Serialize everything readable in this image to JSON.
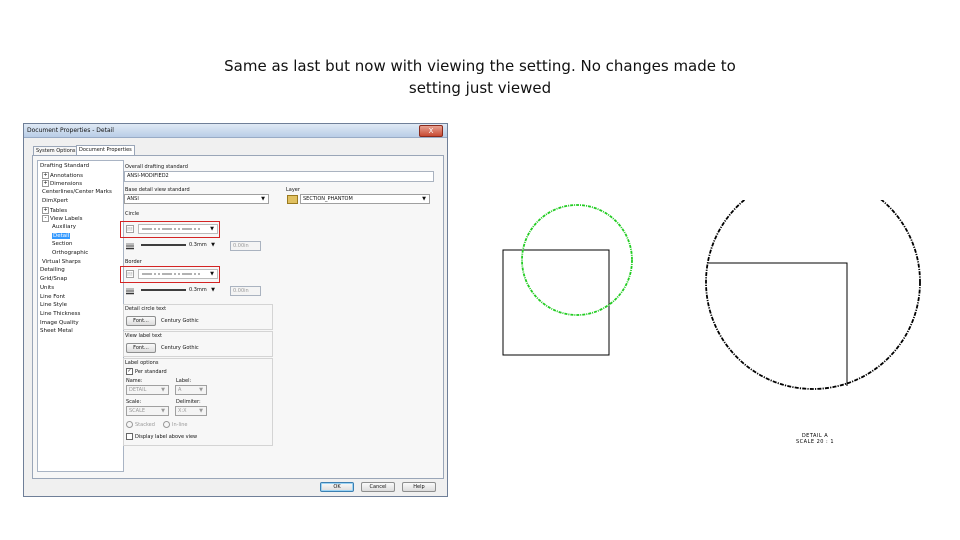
{
  "caption": {
    "line1": "Same as last but now with viewing the setting. No changes made to",
    "line2": "setting just viewed"
  },
  "dialog": {
    "title": "Document Properties - Detail",
    "close": "X",
    "tabs": [
      "System Options",
      "Document Properties"
    ],
    "tree": [
      {
        "label": "Drafting Standard",
        "indent": 0,
        "expander": ""
      },
      {
        "label": "Annotations",
        "indent": 1,
        "expander": "+"
      },
      {
        "label": "Dimensions",
        "indent": 1,
        "expander": "+"
      },
      {
        "label": "Centerlines/Center Marks",
        "indent": 1,
        "expander": ""
      },
      {
        "label": "DimXpert",
        "indent": 1,
        "expander": ""
      },
      {
        "label": "Tables",
        "indent": 1,
        "expander": "+"
      },
      {
        "label": "View Labels",
        "indent": 1,
        "expander": "-"
      },
      {
        "label": "Auxiliary",
        "indent": 2,
        "expander": ""
      },
      {
        "label": "Detail",
        "indent": 2,
        "expander": "",
        "selected": true
      },
      {
        "label": "Section",
        "indent": 2,
        "expander": ""
      },
      {
        "label": "Orthographic",
        "indent": 2,
        "expander": ""
      },
      {
        "label": "Virtual Sharps",
        "indent": 1,
        "expander": ""
      },
      {
        "label": "Detailing",
        "indent": 0,
        "expander": ""
      },
      {
        "label": "Grid/Snap",
        "indent": 0,
        "expander": ""
      },
      {
        "label": "Units",
        "indent": 0,
        "expander": ""
      },
      {
        "label": "Line Font",
        "indent": 0,
        "expander": ""
      },
      {
        "label": "Line Style",
        "indent": 0,
        "expander": ""
      },
      {
        "label": "Line Thickness",
        "indent": 0,
        "expander": ""
      },
      {
        "label": "Image Quality",
        "indent": 0,
        "expander": ""
      },
      {
        "label": "Sheet Metal",
        "indent": 0,
        "expander": ""
      }
    ],
    "overall_label": "Overall drafting standard",
    "overall_value": "ANSI-MODIFIED2",
    "base_label": "Base detail view standard",
    "base_value": "ANSI",
    "layer_label": "Layer",
    "layer_value": "SECTION_PHANTOM",
    "circle_label": "Circle",
    "circle_thickness": "0.3mm",
    "circle_custom": "0.00in",
    "border_label": "Border",
    "border_thickness": "0.3mm",
    "border_custom": "0.00in",
    "detail_circle_text_label": "Detail circle text",
    "font_button": "Font...",
    "detail_circle_font": "Century Gothic",
    "view_label_text_label": "View label text",
    "view_label_font": "Century Gothic",
    "label_options_label": "Label options",
    "per_standard": "Per standard",
    "name_label": "Name:",
    "name_value": "DETAIL",
    "label_label": "Label:",
    "label_value": "A",
    "scale_label": "Scale:",
    "scale_value": "SCALE",
    "delimiter_label": "Delimiter:",
    "delimiter_value": "X:X",
    "stacked": "Stacked",
    "inline": "In-line",
    "display_label_above": "Display label above view",
    "ok": "OK",
    "cancel": "Cancel",
    "help": "Help"
  },
  "drawing": {
    "detail_label_line1": "DETAIL A",
    "detail_label_line2": "SCALE 20 : 1",
    "colors": {
      "detail_circle": "#22cc22",
      "lines": "#000000"
    }
  }
}
